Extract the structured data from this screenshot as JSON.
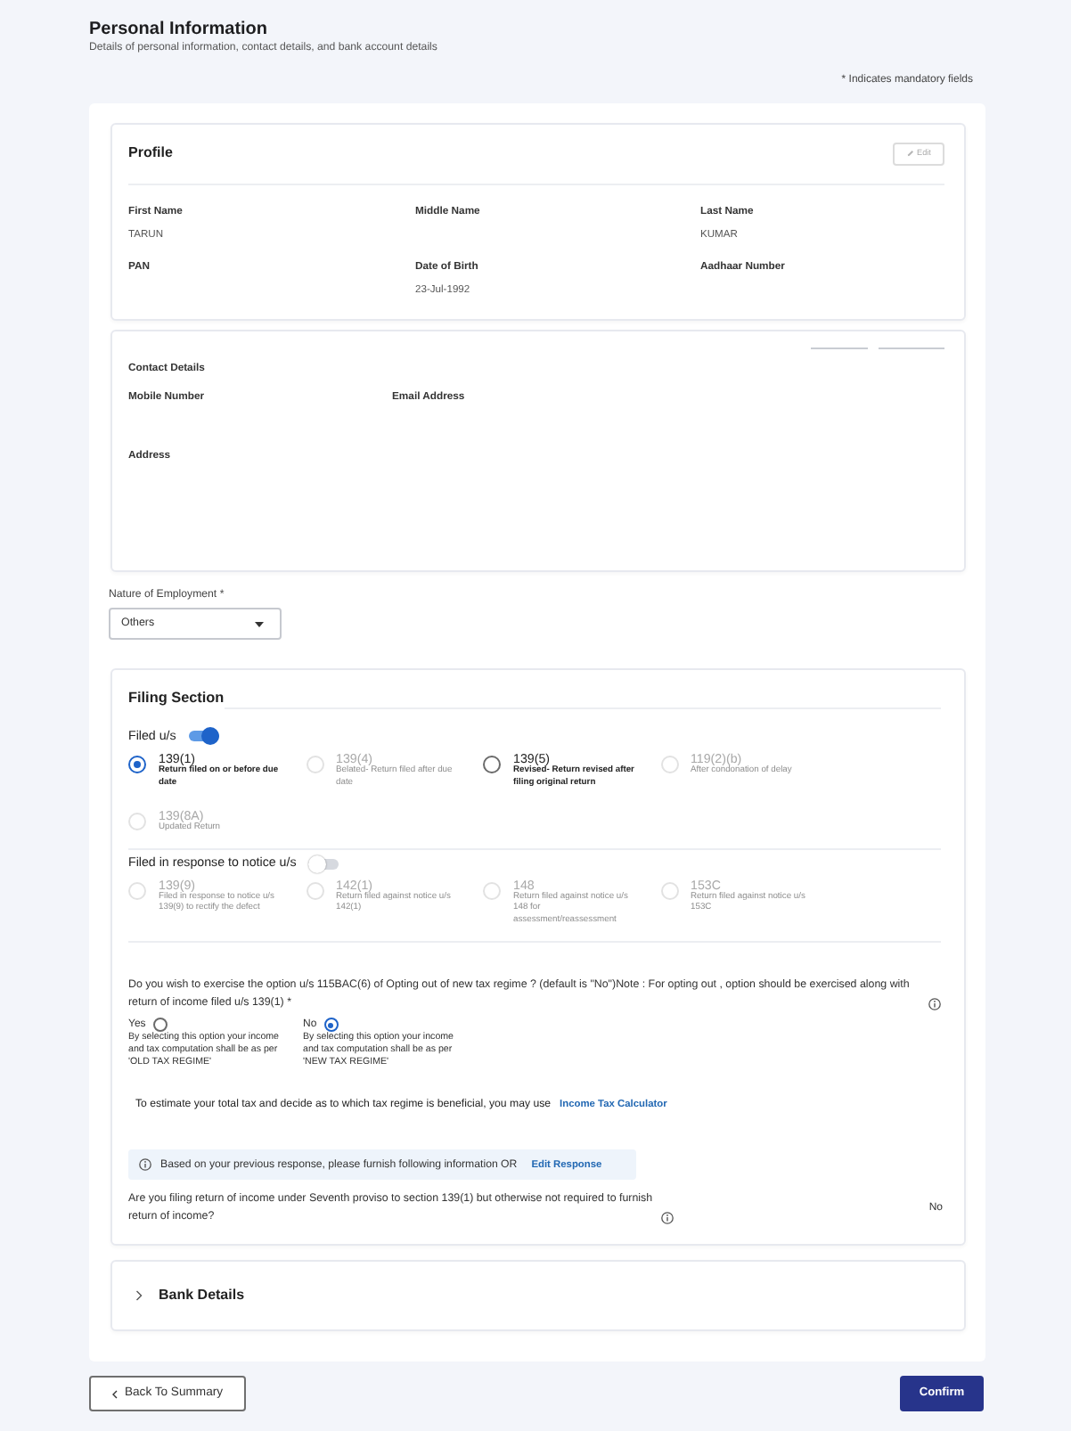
{
  "page": {
    "title": "Personal Information",
    "subtitle": "Details of personal information, contact details, and bank account details",
    "mandatory_note": "* Indicates mandatory fields"
  },
  "profile": {
    "title": "Profile",
    "edit_button": {
      "label": "Edit",
      "disabled": true
    },
    "fields": [
      {
        "label": "First Name",
        "value": "TARUN"
      },
      {
        "label": "Middle Name"
      },
      {
        "label": "Last Name",
        "value": "KUMAR"
      },
      {
        "label": "PAN"
      },
      {
        "label": "Date of Birth",
        "value": "23-Jul-1992"
      },
      {
        "label": "Aadhaar Number"
      }
    ]
  },
  "contact": {
    "title": "Contact Details",
    "rows": [
      [
        "Mobile Number",
        "Email Address"
      ],
      [
        "Address"
      ]
    ]
  },
  "employment": {
    "label": "Nature of Employment *",
    "value": "Others"
  },
  "filing": {
    "title": "Filing Section",
    "filed_us": {
      "label": "Filed u/s",
      "on": true,
      "options": [
        {
          "code": "139(1)",
          "description": "Return filed on or before due date",
          "selected": true,
          "disabled": false
        },
        {
          "code": "139(4)",
          "description": "Belated- Return filed after due date",
          "selected": false,
          "disabled": true
        },
        {
          "code": "139(5)",
          "description": "Revised- Return revised after filing original return",
          "selected": false,
          "disabled": false
        },
        {
          "code": "119(2)(b)",
          "description": "After condonation of delay",
          "selected": false,
          "disabled": true
        },
        {
          "code": "139(8A)",
          "description": "Updated Return",
          "selected": false,
          "disabled": true
        }
      ]
    },
    "notice": {
      "label": "Filed in response to notice u/s",
      "on": false,
      "options": [
        {
          "code": "139(9)",
          "description": "Filed in response to notice u/s 139(9) to rectify the defect",
          "selected": false,
          "disabled": true
        },
        {
          "code": "142(1)",
          "description": "Return filed against notice u/s 142(1)",
          "selected": false,
          "disabled": true
        },
        {
          "code": "148",
          "description": "Return filed against notice u/s 148 for assessment/reassessment",
          "selected": false,
          "disabled": true
        },
        {
          "code": "153C",
          "description": "Return filed against notice u/s 153C",
          "selected": false,
          "disabled": true
        }
      ]
    },
    "regime": {
      "question": "Do you wish to exercise the option u/s 115BAC(6) of Opting out of new tax regime ? (default is \"No\")Note : For opting out , option should be exercised along with return of income filed u/s 139(1) *",
      "options": [
        {
          "label": "Yes",
          "description": "By selecting this option your income and tax computation shall be as per 'OLD TAX REGIME'",
          "selected": false
        },
        {
          "label": "No",
          "description": "By selecting this option your income and tax computation shall be as per 'NEW TAX REGIME'",
          "selected": true
        }
      ]
    },
    "calculator": {
      "text": "To estimate your total tax and decide as to which tax regime is beneficial, you may use",
      "link": "Income Tax Calculator"
    },
    "info": {
      "text": "Based on your previous response, please furnish following information OR",
      "link": "Edit Response"
    },
    "proviso": {
      "question": "Are you filing return of income under Seventh proviso to section 139(1) but otherwise not required to furnish return of income?",
      "answer": "No"
    }
  },
  "bank": {
    "title": "Bank Details",
    "expanded": false
  },
  "actions": {
    "back": "Back To Summary",
    "confirm": "Confirm"
  }
}
